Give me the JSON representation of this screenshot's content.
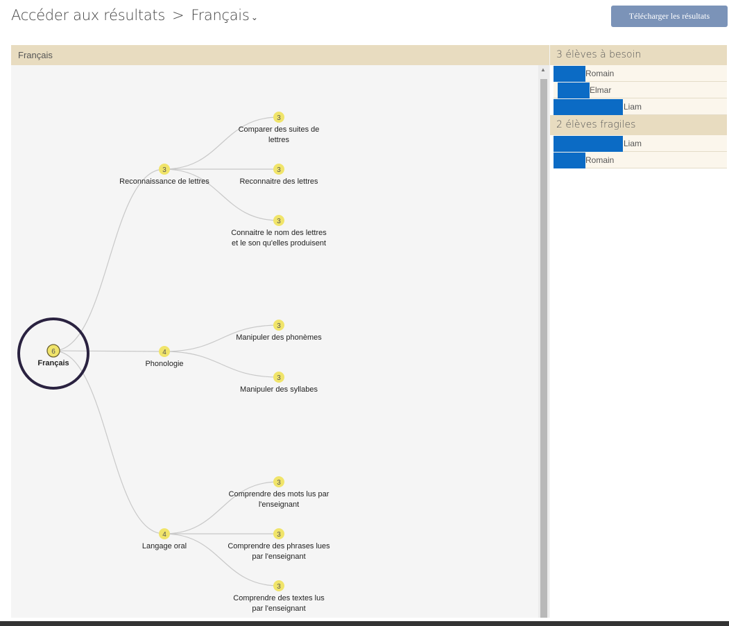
{
  "header": {
    "breadcrumb_root": "Accéder aux résultats",
    "breadcrumb_sep": ">",
    "breadcrumb_current": "Français",
    "download_label": "Télécharger les résultats"
  },
  "panel": {
    "title": "Français"
  },
  "tree": {
    "root": {
      "count": "6",
      "label": "Français"
    },
    "branches": [
      {
        "count": "3",
        "label": "Reconnaissance de lettres",
        "children": [
          {
            "count": "3",
            "lines": [
              "Comparer des suites de",
              "lettres"
            ]
          },
          {
            "count": "3",
            "lines": [
              "Reconnaitre des lettres"
            ]
          },
          {
            "count": "3",
            "lines": [
              "Connaitre le nom des lettres",
              "et le son qu'elles produisent"
            ]
          }
        ]
      },
      {
        "count": "4",
        "label": "Phonologie",
        "children": [
          {
            "count": "3",
            "lines": [
              "Manipuler des phonèmes"
            ]
          },
          {
            "count": "3",
            "lines": [
              "Manipuler des syllabes"
            ]
          }
        ]
      },
      {
        "count": "4",
        "label": "Langage oral",
        "children": [
          {
            "count": "3",
            "lines": [
              "Comprendre des mots lus par",
              "l'enseignant"
            ]
          },
          {
            "count": "3",
            "lines": [
              "Comprendre des phrases lues",
              "par l'enseignant"
            ]
          },
          {
            "count": "3",
            "lines": [
              "Comprendre des textes lus",
              "par l'enseignant"
            ]
          }
        ]
      }
    ]
  },
  "sidebar": {
    "groups": [
      {
        "title": "3 élèves à besoin",
        "students": [
          "Romain",
          "Elmar",
          "Liam"
        ]
      },
      {
        "title": "2 élèves fragiles",
        "students": [
          "Liam",
          "Romain"
        ]
      }
    ]
  },
  "colors": {
    "node_fill": "#f0e46a",
    "link": "#c8c8c8",
    "redaction": "#0b6bc5",
    "accent": "#7b93b8"
  }
}
